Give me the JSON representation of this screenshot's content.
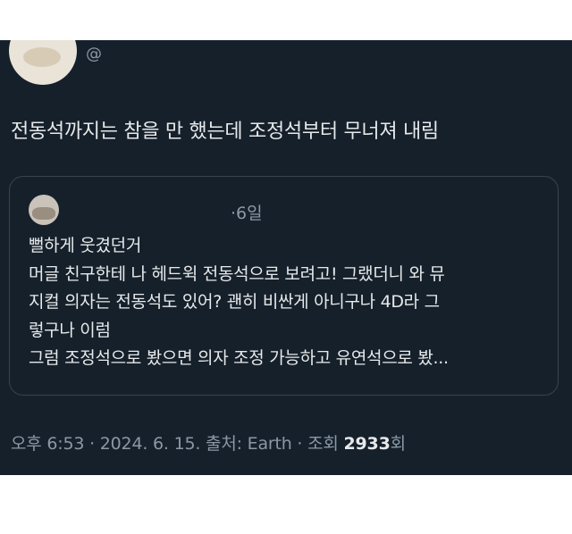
{
  "post": {
    "handle": "@",
    "text": "전동석까지는 참을 만 했는데 조정석부터 무너져 내림"
  },
  "quoted": {
    "time": "·6일",
    "lines": [
      "뻘하게 웃겼던거",
      "머글 친구한테 나 헤드윅 전동석으로 보려고! 그랬더니 와 뮤",
      "지컬 의자는 전동석도 있어? 괜히 비싼게 아니구나 4D라 그",
      "렇구나 이럼",
      "그럼 조정석으로 봤으면 의자 조정 가능하고 유연석으로 봤..."
    ]
  },
  "meta": {
    "timestamp": "오후 6:53 · 2024. 6. 15. 출처: Earth · 조회",
    "views_count": "2933",
    "views_suffix": "회"
  },
  "colors": {
    "background": "#15202b",
    "text": "#e7e9ea",
    "muted": "#8b98a5",
    "border": "#38444d"
  }
}
